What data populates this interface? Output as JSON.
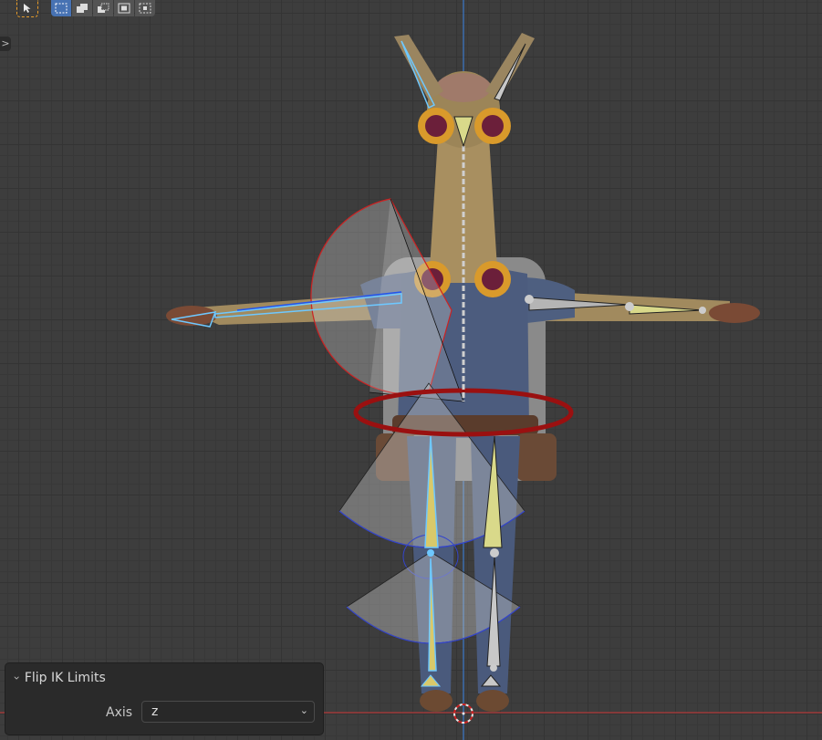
{
  "toolbar": {
    "select_tool_icon": "cursor-icon",
    "modes": [
      "new-selection-icon",
      "extend-selection-icon",
      "subtract-selection-icon",
      "invert-selection-icon",
      "intersect-selection-icon"
    ]
  },
  "sidebar_toggle": {
    "glyph": ">"
  },
  "operator_panel": {
    "title": "Flip IK Limits",
    "axis_label": "Axis",
    "axis_value": "z",
    "dropdown_glyph": "⌄"
  },
  "colors": {
    "viewport_bg": "#3d3d3d",
    "grid": "#343434",
    "accent": "#4772b3",
    "x_axis": "#c0392b",
    "z_axis": "#3b78c9",
    "selected_bone": "#6ec8ff",
    "ik_limit": "#cc2222"
  }
}
